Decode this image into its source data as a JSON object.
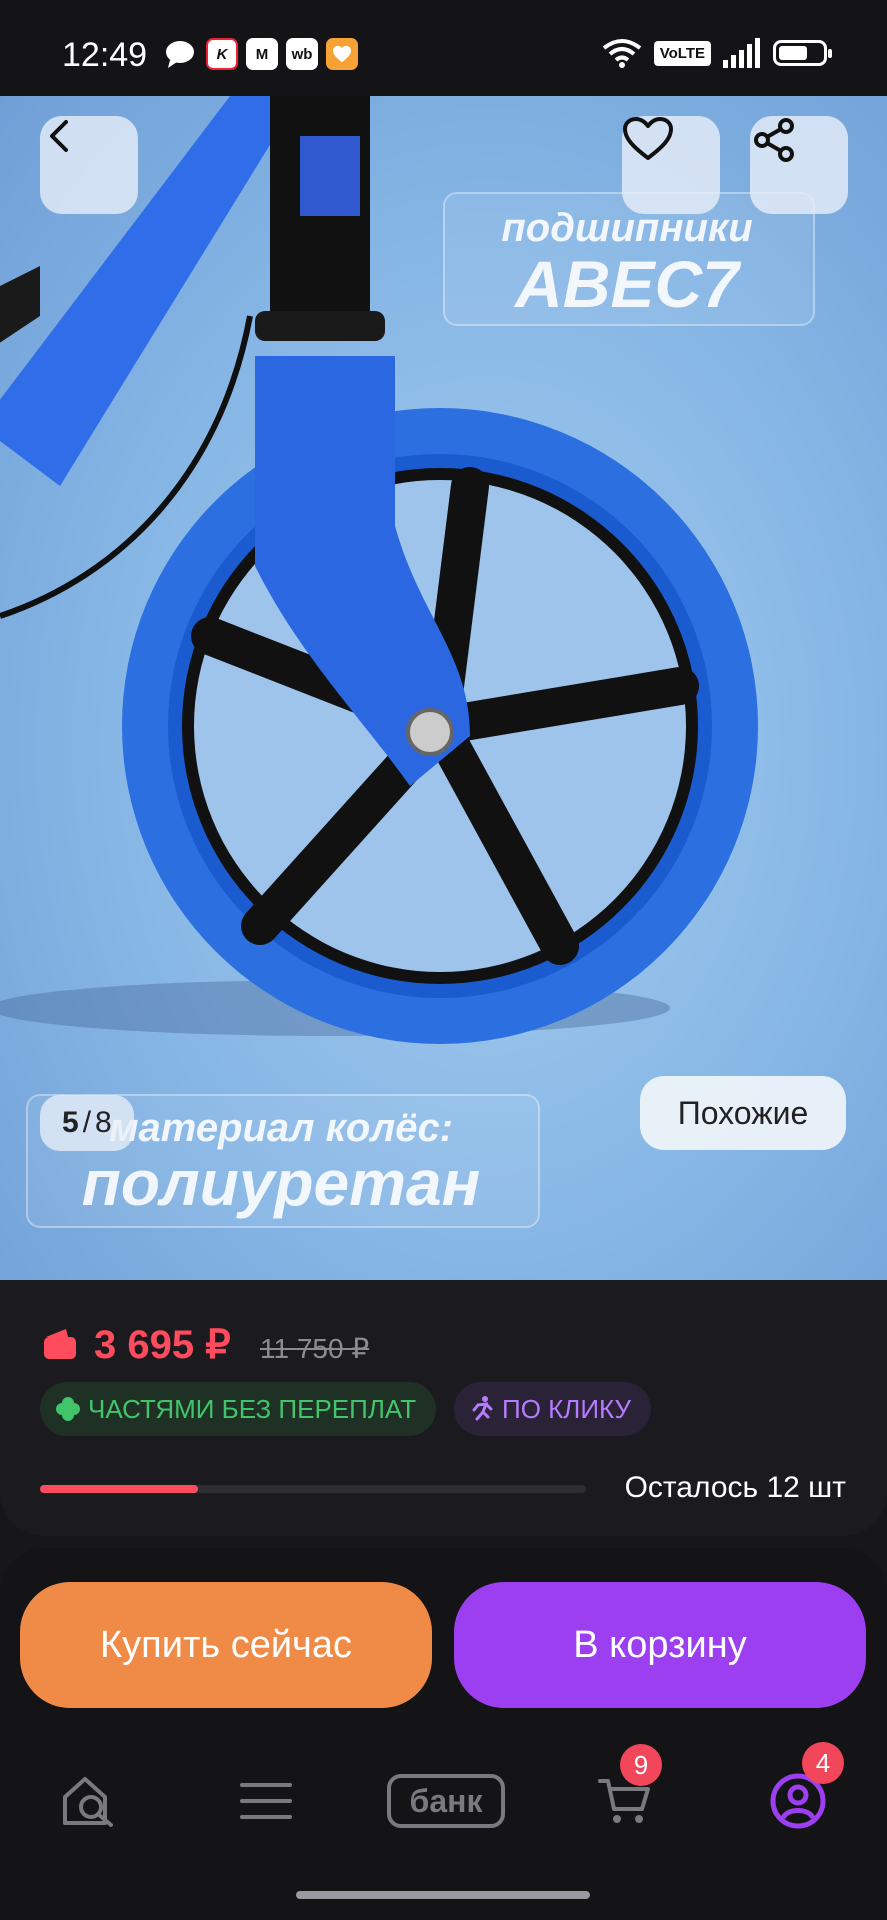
{
  "status_bar": {
    "time": "12:49",
    "app_icons": [
      "chat-bubble-icon",
      "kinopoisk-app-icon",
      "magnit-app-icon",
      "wb-app-icon",
      "heart-app-icon"
    ],
    "app_icon_labels": [
      "K",
      "М",
      "wb"
    ],
    "network_label": "VoLTE",
    "signal_icon": "signal-bars-icon",
    "wifi_icon": "wifi-icon",
    "battery_icon": "battery-icon"
  },
  "product_image": {
    "overlay_top_line1": "подшипники",
    "overlay_top_line2": "ABEC7",
    "overlay_bottom_line1": "материал колёс:",
    "overlay_bottom_line2": "полиуретан",
    "counter_current": "5",
    "counter_separator": "/",
    "counter_total": "8",
    "similar_label": "Похожие",
    "back_icon": "chevron-left-icon",
    "favorite_icon": "heart-icon",
    "share_icon": "share-icon"
  },
  "price_card": {
    "price": "3 695 ₽",
    "old_price": "11 750 ₽",
    "installments_badge": "ЧАСТЯМИ БЕЗ ПЕРЕПЛАТ",
    "click_badge": "ПО КЛИКУ",
    "stock_text": "Осталось 12 шт",
    "stock_progress": 0.29
  },
  "actions": {
    "buy_now": "Купить сейчас",
    "add_to_cart": "В корзину"
  },
  "bottom_nav": {
    "items": [
      "home-search-icon",
      "catalog-menu-icon",
      "bank-icon",
      "cart-icon",
      "profile-icon"
    ],
    "bank_label": "банк",
    "cart_count": "9",
    "profile_count": "4"
  },
  "colors": {
    "price": "#ff4b5e",
    "buy_button": "#f08b47",
    "cart_button": "#9b3ff0",
    "installments": "#42c46b",
    "click": "#b67bff"
  }
}
